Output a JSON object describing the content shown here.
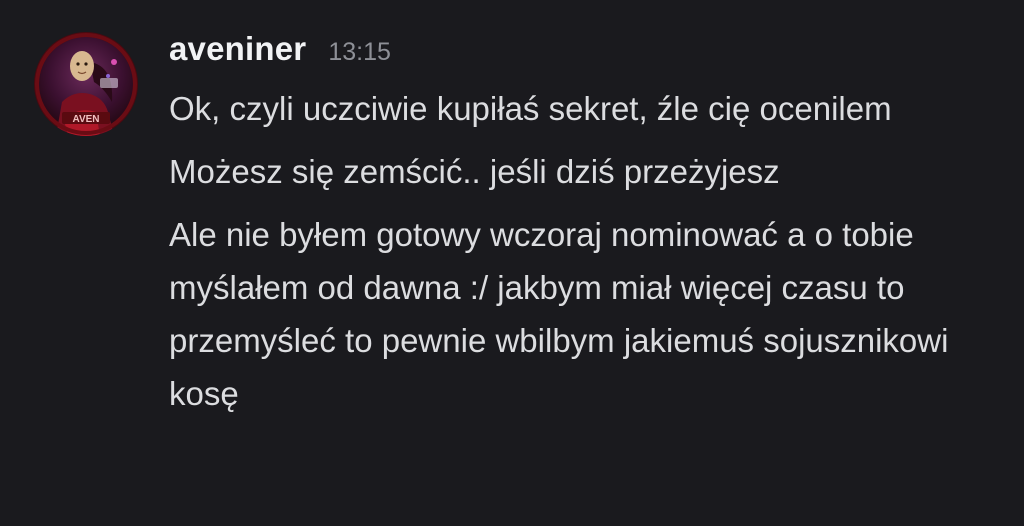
{
  "author": {
    "username": "aveniner",
    "timestamp": "13:15",
    "avatar_badge": "AVEN",
    "avatar_icon": "avatar-image"
  },
  "messages": [
    {
      "text": "Ok, czyli uczciwie kupiłaś sekret, źle cię ocenilem"
    },
    {
      "text": "Możesz się zemścić.. jeśli dziś przeżyjesz"
    },
    {
      "text": "Ale nie byłem gotowy wczoraj nominować a o tobie myślałem od dawna :/ jakbym miał więcej czasu to przemyśleć to pewnie wbilbym jakiemuś sojusznikowi kosę"
    }
  ],
  "colors": {
    "background": "#1a1a1e",
    "username": "#f2f3f5",
    "timestamp": "#8e9097",
    "message": "#dcdde0"
  }
}
